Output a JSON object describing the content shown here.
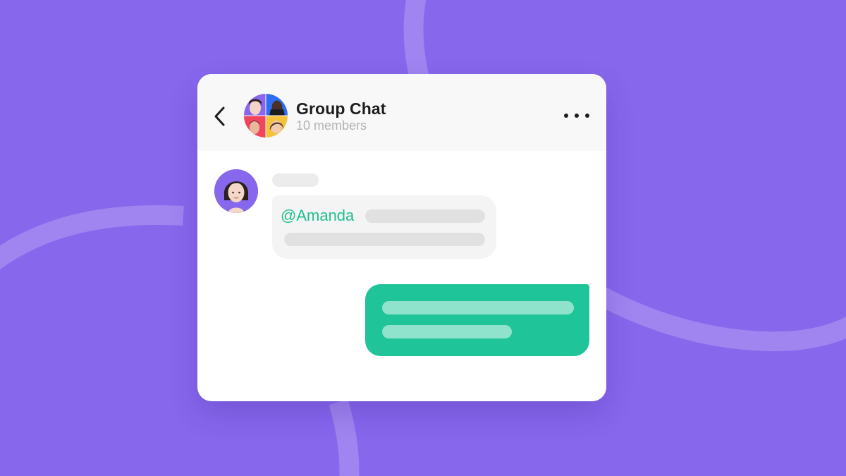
{
  "theme": {
    "background": "#8767ec",
    "accent_green": "#1fc498",
    "mention_color": "#1fc08f"
  },
  "header": {
    "back_icon": "chevron-left-icon",
    "title": "Group Chat",
    "subtitle": "10 members",
    "more_icon": "ellipsis-horizontal-icon"
  },
  "messages": {
    "incoming": {
      "mention": "@Amanda"
    }
  }
}
